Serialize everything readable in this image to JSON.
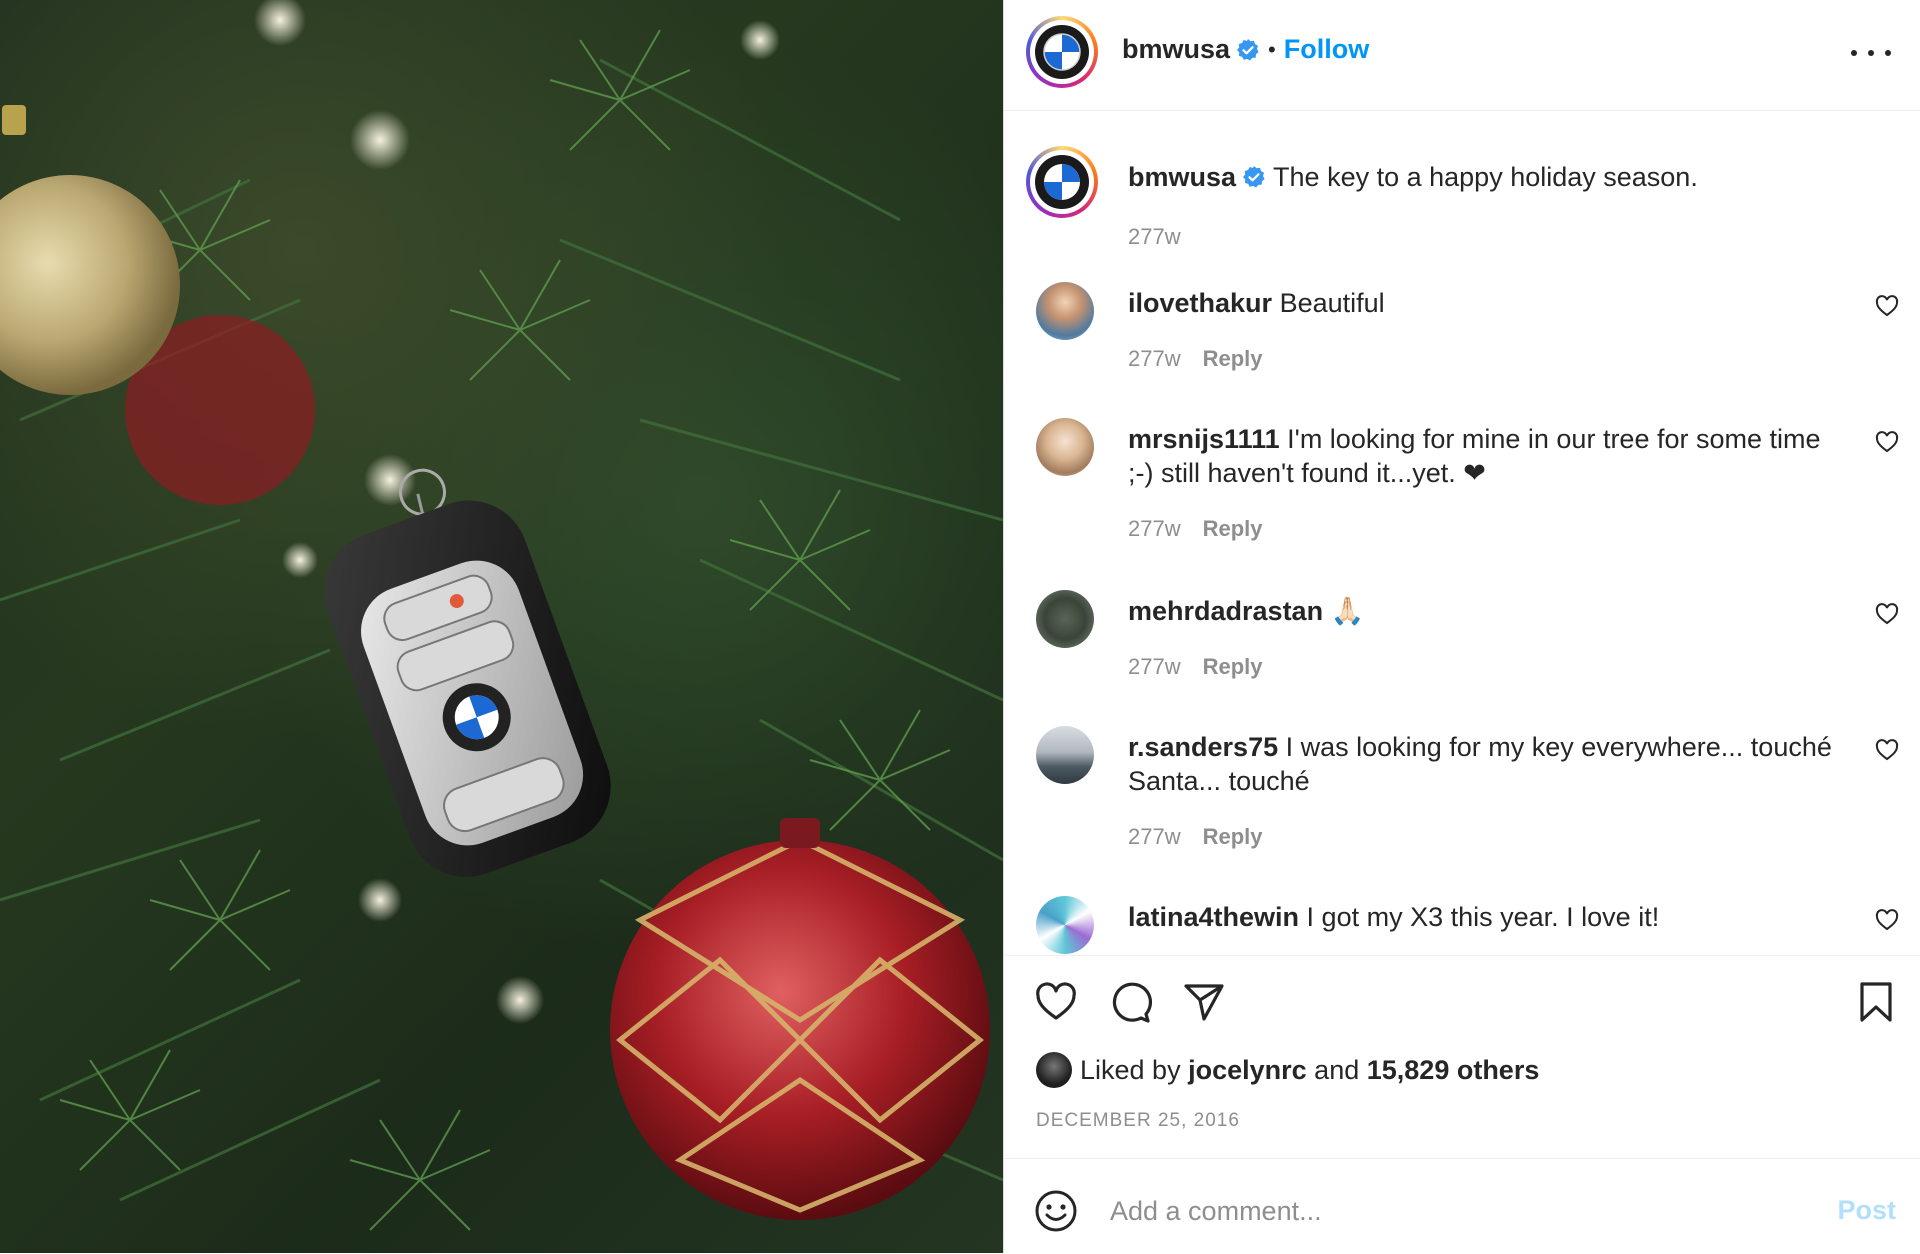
{
  "post": {
    "author": "bmwusa",
    "follow_label": "Follow",
    "separator": "•",
    "verified_icon": "verified-badge-icon",
    "more_icon": "more-options-icon"
  },
  "caption": {
    "username": "bmwusa",
    "text": "The key to a happy holiday season.",
    "time": "277w"
  },
  "comments": [
    {
      "username": "ilovethakur",
      "text": "Beautiful",
      "time": "277w",
      "reply": "Reply"
    },
    {
      "username": "mrsnijs1111",
      "text": "I'm looking for mine in our tree for some time ;-) still haven't found it...yet. ❤",
      "time": "277w",
      "reply": "Reply"
    },
    {
      "username": "mehrdadrastan",
      "text": "🙏🏻",
      "time": "277w",
      "reply": "Reply"
    },
    {
      "username": "r.sanders75",
      "text": "I was looking for my key everywhere... touché Santa... touché",
      "time": "277w",
      "reply": "Reply"
    },
    {
      "username": "latina4thewin",
      "text": "I got my X3 this year. I love it!",
      "time": "",
      "reply": ""
    }
  ],
  "likes": {
    "prefix": "Liked by",
    "user": "jocelynrc",
    "and": "and",
    "others": "15,829 others"
  },
  "date": "DECEMBER 25, 2016",
  "comment_box": {
    "placeholder": "Add a comment...",
    "post_label": "Post"
  },
  "colors": {
    "accent": "#0095f6",
    "post_disabled": "#b2dffc",
    "muted": "#8e8e8e",
    "text": "#262626"
  }
}
